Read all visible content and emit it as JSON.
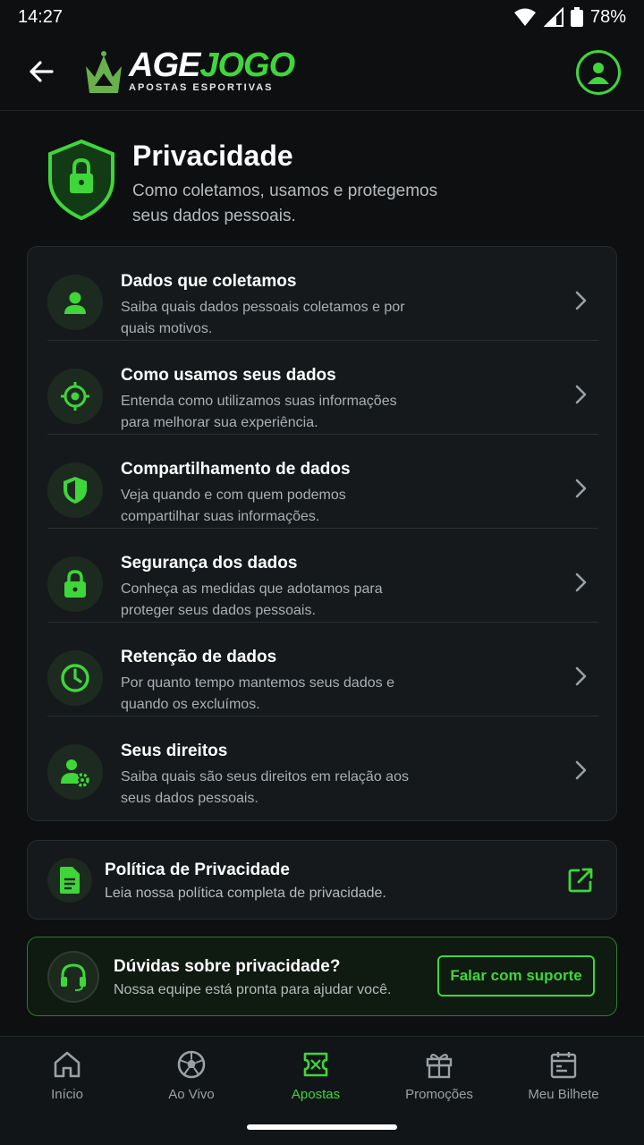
{
  "status_bar": {
    "time": "14:27",
    "battery": "78%"
  },
  "header": {
    "logo_age": "AGE",
    "logo_jogo": "JOGO",
    "logo_sub": "APOSTAS ESPORTIVAS",
    "back_icon": "arrow-left-icon",
    "profile_icon": "user-circle-icon"
  },
  "hero": {
    "title": "Privacidade",
    "subtitle": "Como coletamos, usamos e protegemos seus dados pessoais.",
    "icon": "shield-lock-icon"
  },
  "items": [
    {
      "title": "Dados que coletamos",
      "desc": "Saiba quais dados pessoais coletamos e por quais motivos.",
      "icon": "user-icon"
    },
    {
      "title": "Como usamos seus dados",
      "desc": "Entenda como utilizamos suas informações para melhorar sua experiência.",
      "icon": "target-icon"
    },
    {
      "title": "Compartilhamento de dados",
      "desc": "Veja quando e com quem podemos compartilhar suas informações.",
      "icon": "shield-icon"
    },
    {
      "title": "Segurança dos dados",
      "desc": "Conheça as medidas que adotamos para proteger seus dados pessoais.",
      "icon": "lock-icon"
    },
    {
      "title": "Retenção de dados",
      "desc": "Por quanto tempo mantemos seus dados e quando os excluímos.",
      "icon": "clock-icon"
    },
    {
      "title": "Seus direitos",
      "desc": "Saiba quais são seus direitos em relação aos seus dados pessoais.",
      "icon": "user-gear-icon"
    }
  ],
  "policy": {
    "title": "Política de Privacidade",
    "desc": "Leia nossa política completa de privacidade.",
    "icon": "document-icon",
    "action_icon": "external-link-icon"
  },
  "support": {
    "title": "Dúvidas sobre privacidade?",
    "desc": "Nossa equipe está pronta para ajudar você.",
    "button": "Falar com suporte",
    "icon": "headset-icon"
  },
  "bottom_nav": [
    {
      "label": "Início",
      "icon": "home-icon",
      "active": false
    },
    {
      "label": "Ao Vivo",
      "icon": "soccer-ball-icon",
      "active": false
    },
    {
      "label": "Apostas",
      "icon": "ticket-icon",
      "active": true
    },
    {
      "label": "Promoções",
      "icon": "gift-icon",
      "active": false
    },
    {
      "label": "Meu Bilhete",
      "icon": "calendar-icon",
      "active": false
    }
  ],
  "colors": {
    "accent": "#3fd63a",
    "background": "#0d0f10",
    "card": "#15191b"
  }
}
